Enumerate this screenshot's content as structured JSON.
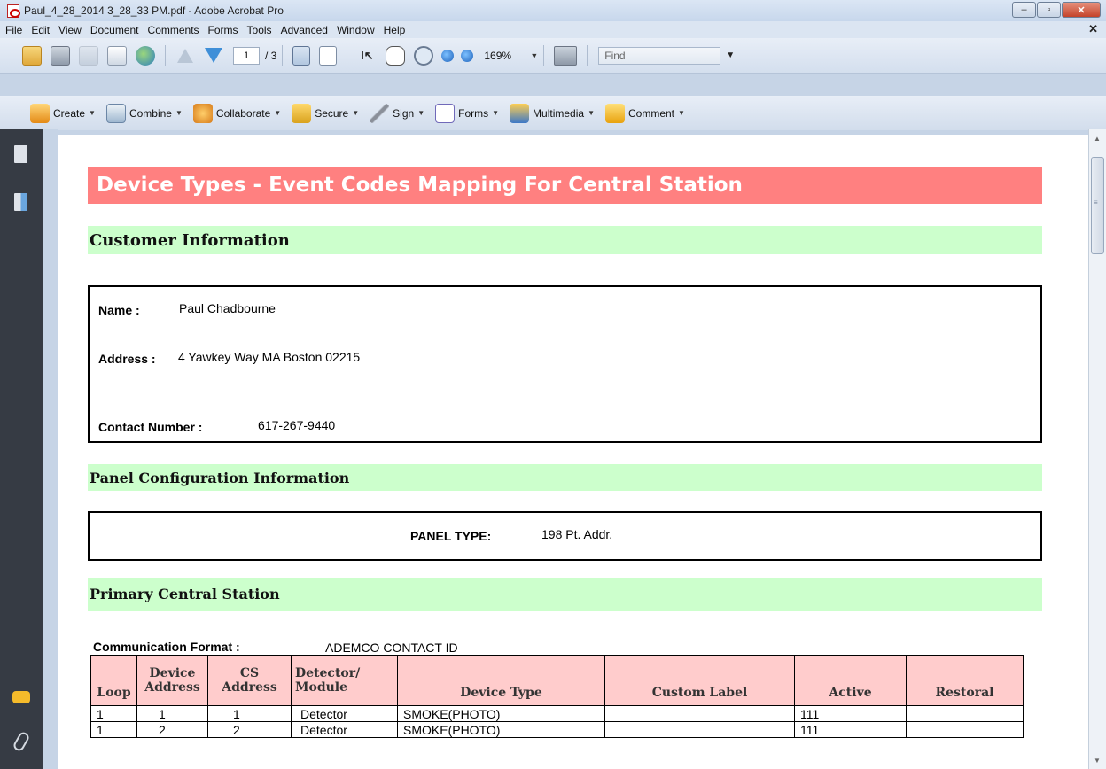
{
  "window": {
    "title": "Paul_4_28_2014 3_28_33 PM.pdf - Adobe Acrobat Pro",
    "minimize": "–",
    "maximize": "▫",
    "close": "✕",
    "doc_close": "✕"
  },
  "menu": [
    "File",
    "Edit",
    "View",
    "Document",
    "Comments",
    "Forms",
    "Tools",
    "Advanced",
    "Window",
    "Help"
  ],
  "toolbar": {
    "page_current": "1",
    "page_total": "/ 3",
    "zoom": "169%",
    "find_placeholder": "Find"
  },
  "tasks": [
    {
      "label": "Create",
      "icon": "create-icon"
    },
    {
      "label": "Combine",
      "icon": "combine-icon"
    },
    {
      "label": "Collaborate",
      "icon": "collaborate-icon"
    },
    {
      "label": "Secure",
      "icon": "lock-icon"
    },
    {
      "label": "Sign",
      "icon": "pen-icon"
    },
    {
      "label": "Forms",
      "icon": "form-icon"
    },
    {
      "label": "Multimedia",
      "icon": "multimedia-icon"
    },
    {
      "label": "Comment",
      "icon": "comment-icon"
    }
  ],
  "document": {
    "title": "Device Types - Event Codes Mapping For Central Station",
    "customer_heading": "Customer Information",
    "customer": {
      "name_label": "Name :",
      "name": "Paul Chadbourne",
      "address_label": "Address :",
      "address": "4 Yawkey Way  MA Boston 02215",
      "contact_label": "Contact Number :",
      "contact": "617-267-9440"
    },
    "panel_heading": "Panel Configuration Information",
    "panel": {
      "type_label": "PANEL TYPE:",
      "type": "198 Pt. Addr."
    },
    "primary_heading": "Primary Central Station",
    "communication_label": "Communication Format :",
    "communication_value": "ADEMCO CONTACT ID",
    "table": {
      "columns": [
        "Loop",
        "Device Address",
        "CS Address",
        "Detector/ Module",
        "Device Type",
        "Custom Label",
        "Active",
        "Restoral"
      ],
      "rows": [
        [
          "1",
          "1",
          "1",
          "Detector",
          "SMOKE(PHOTO)",
          "",
          "111",
          ""
        ],
        [
          "1",
          "2",
          "2",
          "Detector",
          "SMOKE(PHOTO)",
          "",
          "111",
          ""
        ]
      ]
    }
  }
}
